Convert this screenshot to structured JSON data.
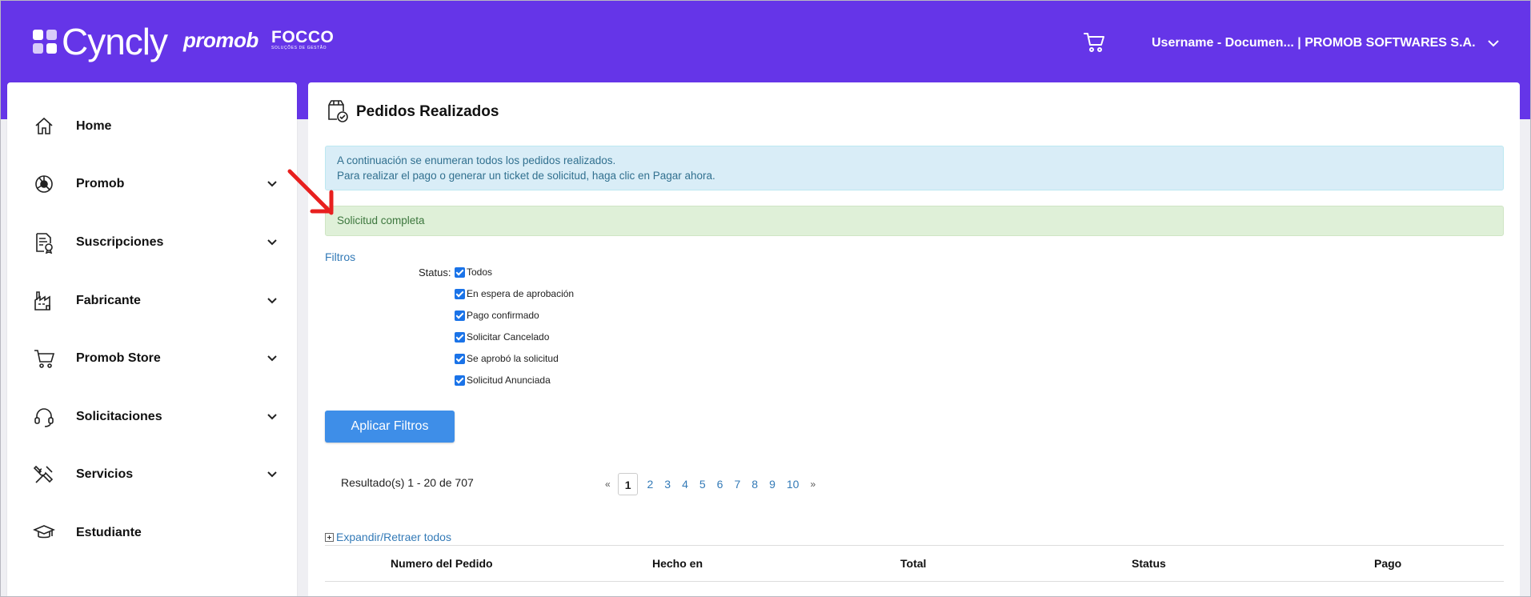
{
  "header": {
    "brand": "Cyncly",
    "partner1": "promob",
    "partner2": "FOCCO",
    "partner2_sub": "SOLUÇÕES DE GESTÃO",
    "user": "Username - Documen... | PROMOB SOFTWARES S.A."
  },
  "sidebar": {
    "items": [
      {
        "label": "Home",
        "icon": "home-icon",
        "expandable": false
      },
      {
        "label": "Promob",
        "icon": "promob-icon",
        "expandable": true
      },
      {
        "label": "Suscripciones",
        "icon": "subscription-icon",
        "expandable": true
      },
      {
        "label": "Fabricante",
        "icon": "factory-icon",
        "expandable": true
      },
      {
        "label": "Promob Store",
        "icon": "cart-icon",
        "expandable": true
      },
      {
        "label": "Solicitaciones",
        "icon": "headset-icon",
        "expandable": true
      },
      {
        "label": "Servicios",
        "icon": "tools-icon",
        "expandable": true
      },
      {
        "label": "Estudiante",
        "icon": "graduation-cap-icon",
        "expandable": false
      }
    ]
  },
  "main": {
    "title": "Pedidos Realizados",
    "info_line1": "A continuación se enumeran todos los pedidos realizados.",
    "info_line2": "Para realizar el pago o generar un ticket de solicitud, haga clic en Pagar ahora.",
    "success": "Solicitud completa",
    "filters_label": "Filtros",
    "status_label": "Status:",
    "statuses": [
      {
        "label": "Todos",
        "checked": true
      },
      {
        "label": "En espera de aprobación",
        "checked": true
      },
      {
        "label": "Pago confirmado",
        "checked": true
      },
      {
        "label": "Solicitar Cancelado",
        "checked": true
      },
      {
        "label": "Se aprobó la solicitud",
        "checked": true
      },
      {
        "label": "Solicitud Anunciada",
        "checked": true
      }
    ],
    "apply_button": "Aplicar Filtros",
    "result_count": "Resultado(s) 1 - 20 de 707",
    "pagination": {
      "prev": "«",
      "next": "»",
      "pages": [
        "1",
        "2",
        "3",
        "4",
        "5",
        "6",
        "7",
        "8",
        "9",
        "10"
      ],
      "current": "1"
    },
    "expand_label": "Expandir/Retraer todos",
    "columns": [
      "Numero del Pedido",
      "Hecho en",
      "Total",
      "Status",
      "Pago"
    ]
  },
  "colors": {
    "header_bg": "#6535e8",
    "info_bg": "#d9edf7",
    "success_bg": "#dff0d8",
    "button_bg": "#3e8ee8",
    "link": "#337ab7",
    "annotation_arrow": "#e8201f"
  }
}
